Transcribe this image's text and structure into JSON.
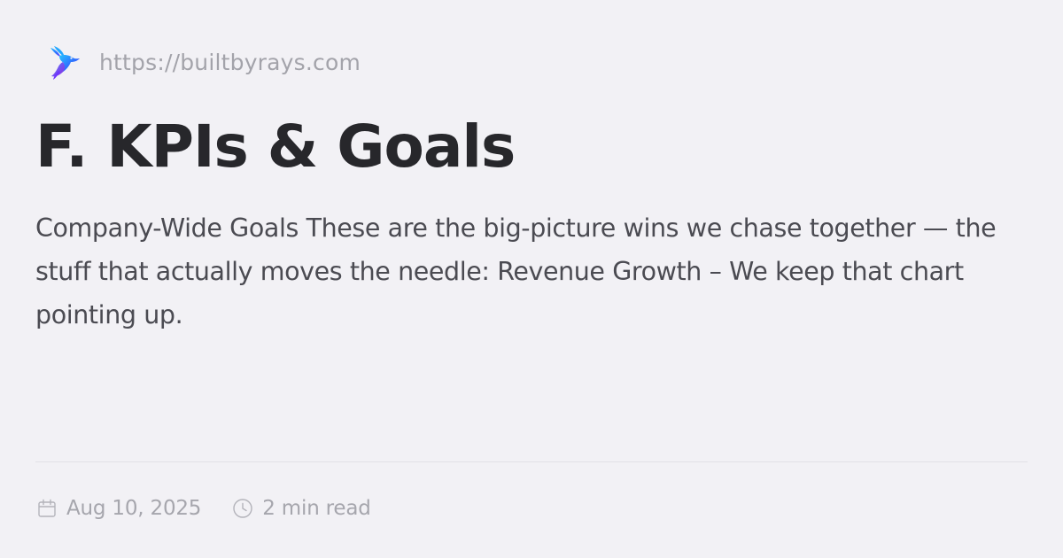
{
  "site": {
    "logo_icon": "hummingbird-logo-icon",
    "url": "https://builtbyrays.com"
  },
  "article": {
    "title": "F. KPIs & Goals",
    "description": "Company-Wide Goals These are the big-picture wins we chase together — the stuff that actually moves the needle: Revenue Growth – We keep that chart pointing up."
  },
  "meta": {
    "date_icon": "calendar-icon",
    "date": "Aug 10, 2025",
    "read_time_icon": "clock-icon",
    "read_time": "2 min read"
  },
  "colors": {
    "background": "#f2f1f5",
    "title": "#27272b",
    "body_text": "#4b4b52",
    "muted_text": "#a6a6ad",
    "logo_blue": "#2f6bff",
    "logo_purple": "#7b3cff",
    "logo_cyan": "#31b7ff"
  }
}
